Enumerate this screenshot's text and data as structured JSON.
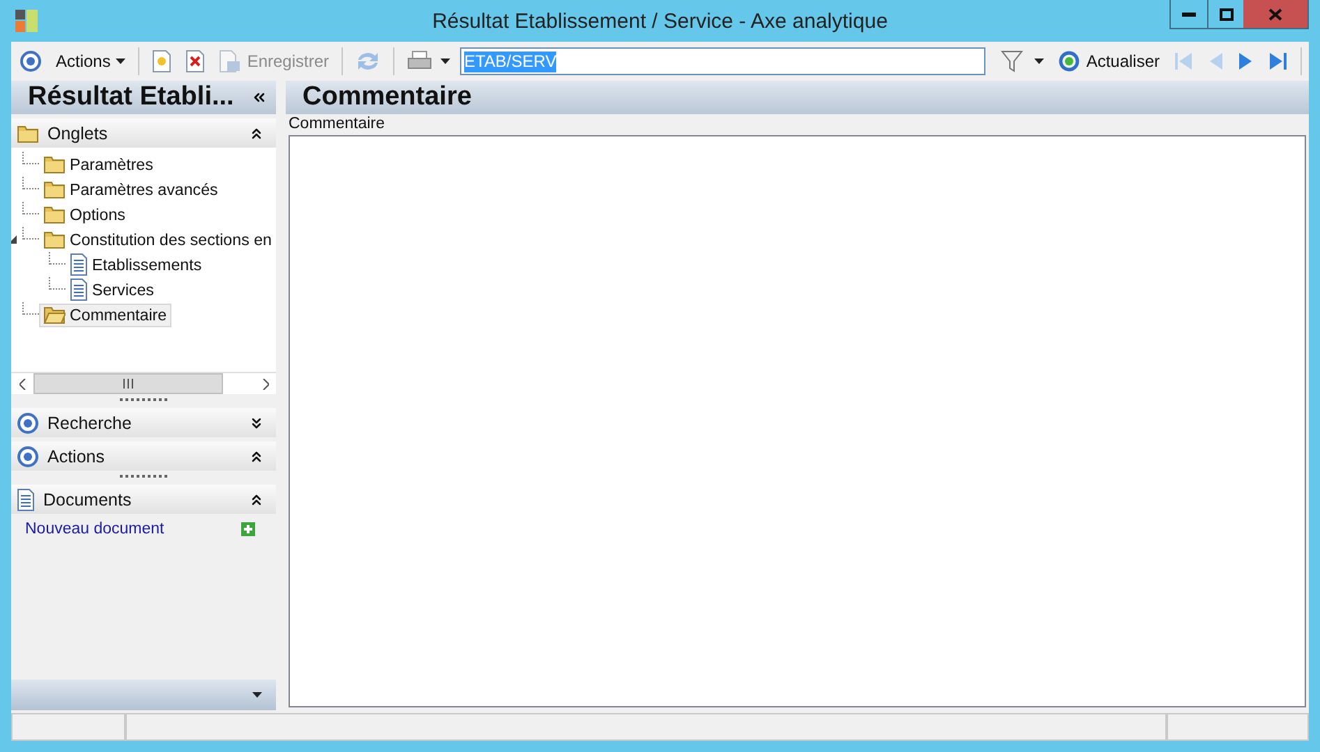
{
  "window": {
    "title": "Résultat Etablissement / Service -  Axe analytique"
  },
  "toolbar": {
    "actions_label": "Actions",
    "new_disabled": false,
    "delete_disabled": false,
    "save": {
      "label": "Enregistrer",
      "disabled": true
    },
    "sync_disabled": true,
    "search_value": "ETAB/SERV",
    "refresh_label": "Actualiser",
    "nav": [
      {
        "kind": "first",
        "disabled": true
      },
      {
        "kind": "prev",
        "disabled": true
      },
      {
        "kind": "next",
        "disabled": false
      },
      {
        "kind": "last",
        "disabled": false
      }
    ]
  },
  "sidebar": {
    "title": "Résultat Etabli...",
    "tabs_section": {
      "title": "Onglets",
      "expanded": true
    },
    "tree": [
      {
        "label": "Paramètres",
        "kind": "folder",
        "selected": false
      },
      {
        "label": "Paramètres avancés",
        "kind": "folder",
        "selected": false
      },
      {
        "label": "Options",
        "kind": "folder",
        "selected": false
      },
      {
        "label": "Constitution des sections en",
        "kind": "folder",
        "selected": false,
        "expanded": true,
        "children": [
          {
            "label": "Etablissements",
            "kind": "document",
            "selected": false
          },
          {
            "label": "Services",
            "kind": "document",
            "selected": false
          }
        ]
      },
      {
        "label": "Commentaire",
        "kind": "folder",
        "selected": true
      }
    ],
    "sections": [
      {
        "title": "Recherche",
        "kind": "target",
        "expanded": false
      },
      {
        "title": "Actions",
        "kind": "target",
        "expanded": true
      },
      {
        "title": "Documents",
        "kind": "document",
        "expanded": true,
        "links": [
          {
            "label": "Nouveau document"
          }
        ]
      }
    ]
  },
  "main": {
    "title": "Commentaire",
    "group_label": "Commentaire"
  }
}
